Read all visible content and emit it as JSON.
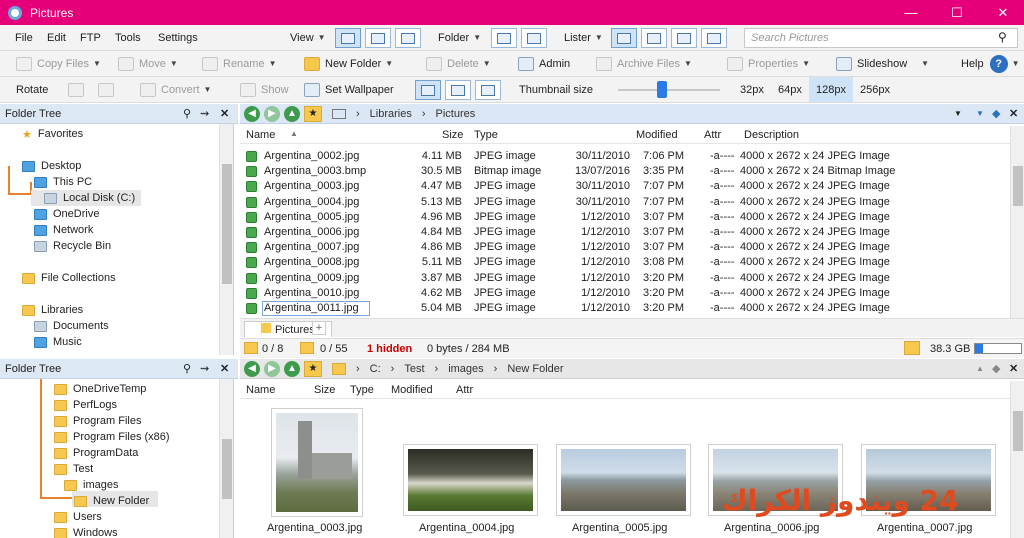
{
  "window": {
    "title": "Pictures"
  },
  "menu": [
    "File",
    "Edit",
    "FTP",
    "Tools",
    "Settings"
  ],
  "toolbar1": {
    "view": "View",
    "folder": "Folder",
    "lister": "Lister",
    "search_placeholder": "Search Pictures"
  },
  "toolbar2": {
    "copy": "Copy Files",
    "move": "Move",
    "rename": "Rename",
    "new_folder": "New Folder",
    "delete": "Delete",
    "admin": "Admin",
    "archive": "Archive Files",
    "properties": "Properties",
    "slideshow": "Slideshow",
    "help": "Help"
  },
  "toolbar3": {
    "rotate": "Rotate",
    "convert": "Convert",
    "show": "Show",
    "wallpaper": "Set Wallpaper",
    "thumb_size": "Thumbnail size",
    "sizes": [
      "32px",
      "64px",
      "128px",
      "256px"
    ],
    "selected_size": "128px"
  },
  "tree_top": {
    "header": "Folder Tree",
    "items": [
      "Favorites",
      "Desktop",
      "This PC",
      "Local Disk (C:)",
      "OneDrive",
      "Network",
      "Recycle Bin",
      "File Collections",
      "Libraries",
      "Documents",
      "Music"
    ]
  },
  "tree_bottom": {
    "header": "Folder Tree",
    "items": [
      "OneDriveTemp",
      "PerfLogs",
      "Program Files",
      "Program Files (x86)",
      "ProgramData",
      "Test",
      "images",
      "New Folder",
      "Users",
      "Windows"
    ]
  },
  "top_pane": {
    "breadcrumb": [
      "Libraries",
      "Pictures"
    ],
    "columns": [
      "Name",
      "Size",
      "Type",
      "Modified",
      "Attr",
      "Description"
    ],
    "rows": [
      [
        "Argentina_0002.jpg",
        "4.11 MB",
        "JPEG image",
        "30/11/2010",
        "7:06 PM",
        "-a----",
        "4000 x 2672 x 24 JPEG Image"
      ],
      [
        "Argentina_0003.bmp",
        "30.5 MB",
        "Bitmap image",
        "13/07/2016",
        "3:35 PM",
        "-a----",
        "4000 x 2672 x 24 Bitmap Image"
      ],
      [
        "Argentina_0003.jpg",
        "4.47 MB",
        "JPEG image",
        "30/11/2010",
        "7:07 PM",
        "-a----",
        "4000 x 2672 x 24 JPEG Image"
      ],
      [
        "Argentina_0004.jpg",
        "5.13 MB",
        "JPEG image",
        "30/11/2010",
        "7:07 PM",
        "-a----",
        "4000 x 2672 x 24 JPEG Image"
      ],
      [
        "Argentina_0005.jpg",
        "4.96 MB",
        "JPEG image",
        "1/12/2010",
        "3:07 PM",
        "-a----",
        "4000 x 2672 x 24 JPEG Image"
      ],
      [
        "Argentina_0006.jpg",
        "4.84 MB",
        "JPEG image",
        "1/12/2010",
        "3:07 PM",
        "-a----",
        "4000 x 2672 x 24 JPEG Image"
      ],
      [
        "Argentina_0007.jpg",
        "4.86 MB",
        "JPEG image",
        "1/12/2010",
        "3:07 PM",
        "-a----",
        "4000 x 2672 x 24 JPEG Image"
      ],
      [
        "Argentina_0008.jpg",
        "5.11 MB",
        "JPEG image",
        "1/12/2010",
        "3:08 PM",
        "-a----",
        "4000 x 2672 x 24 JPEG Image"
      ],
      [
        "Argentina_0009.jpg",
        "3.87 MB",
        "JPEG image",
        "1/12/2010",
        "3:20 PM",
        "-a----",
        "4000 x 2672 x 24 JPEG Image"
      ],
      [
        "Argentina_0010.jpg",
        "4.62 MB",
        "JPEG image",
        "1/12/2010",
        "3:20 PM",
        "-a----",
        "4000 x 2672 x 24 JPEG Image"
      ],
      [
        "Argentina_0011.jpg",
        "5.04 MB",
        "JPEG image",
        "1/12/2010",
        "3:20 PM",
        "-a----",
        "4000 x 2672 x 24 JPEG Image"
      ]
    ],
    "tab": "Pictures",
    "status": {
      "selected": "0 / 8",
      "folders": "0 / 55",
      "hidden": "1 hidden",
      "bytes": "0 bytes / 284 MB",
      "free": "38.3 GB"
    }
  },
  "bottom_pane": {
    "breadcrumb": [
      "C:",
      "Test",
      "images",
      "New Folder"
    ],
    "columns": [
      "Name",
      "Size",
      "Type",
      "Modified",
      "Attr"
    ],
    "thumbs": [
      "Argentina_0003.jpg",
      "Argentina_0004.jpg",
      "Argentina_0005.jpg",
      "Argentina_0006.jpg",
      "Argentina_0007.jpg"
    ]
  },
  "watermark": "24 ويندوز الكراك",
  "colors": {
    "titlebar": "#e5007a",
    "accent": "#4a90d9",
    "hidden": "#cc0000",
    "watermark": "#e04a1f"
  }
}
